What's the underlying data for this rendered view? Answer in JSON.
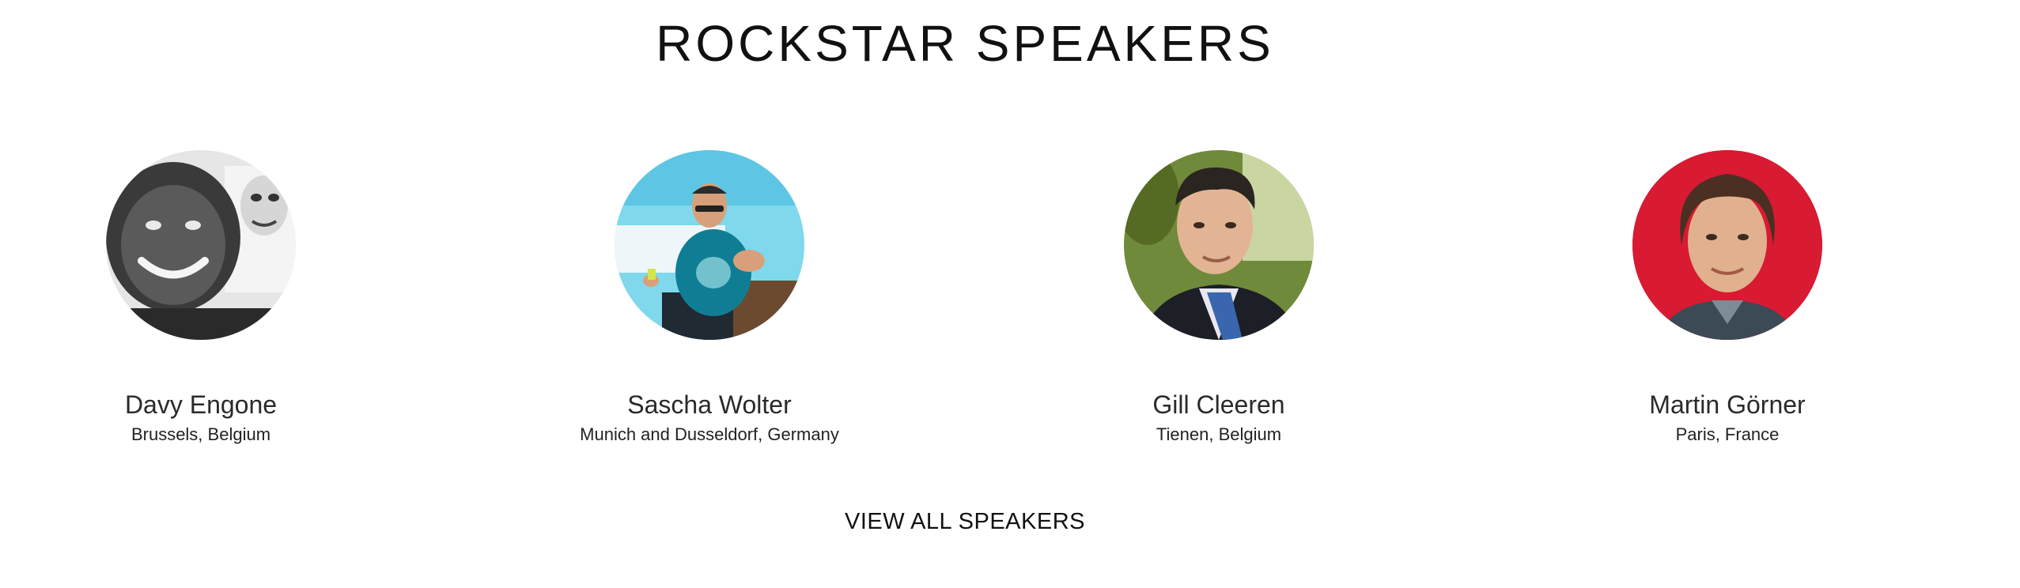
{
  "section": {
    "title": "ROCKSTAR SPEAKERS",
    "view_all_label": "VIEW ALL SPEAKERS"
  },
  "speakers": [
    {
      "name": "Davy Engone",
      "location": "Brussels, Belgium"
    },
    {
      "name": "Sascha Wolter",
      "location": "Munich and Dusseldorf, Germany"
    },
    {
      "name": "Gill Cleeren",
      "location": "Tienen, Belgium"
    },
    {
      "name": "Martin Görner",
      "location": "Paris, France"
    }
  ],
  "colors": {
    "text": "#111111",
    "background": "#ffffff"
  }
}
